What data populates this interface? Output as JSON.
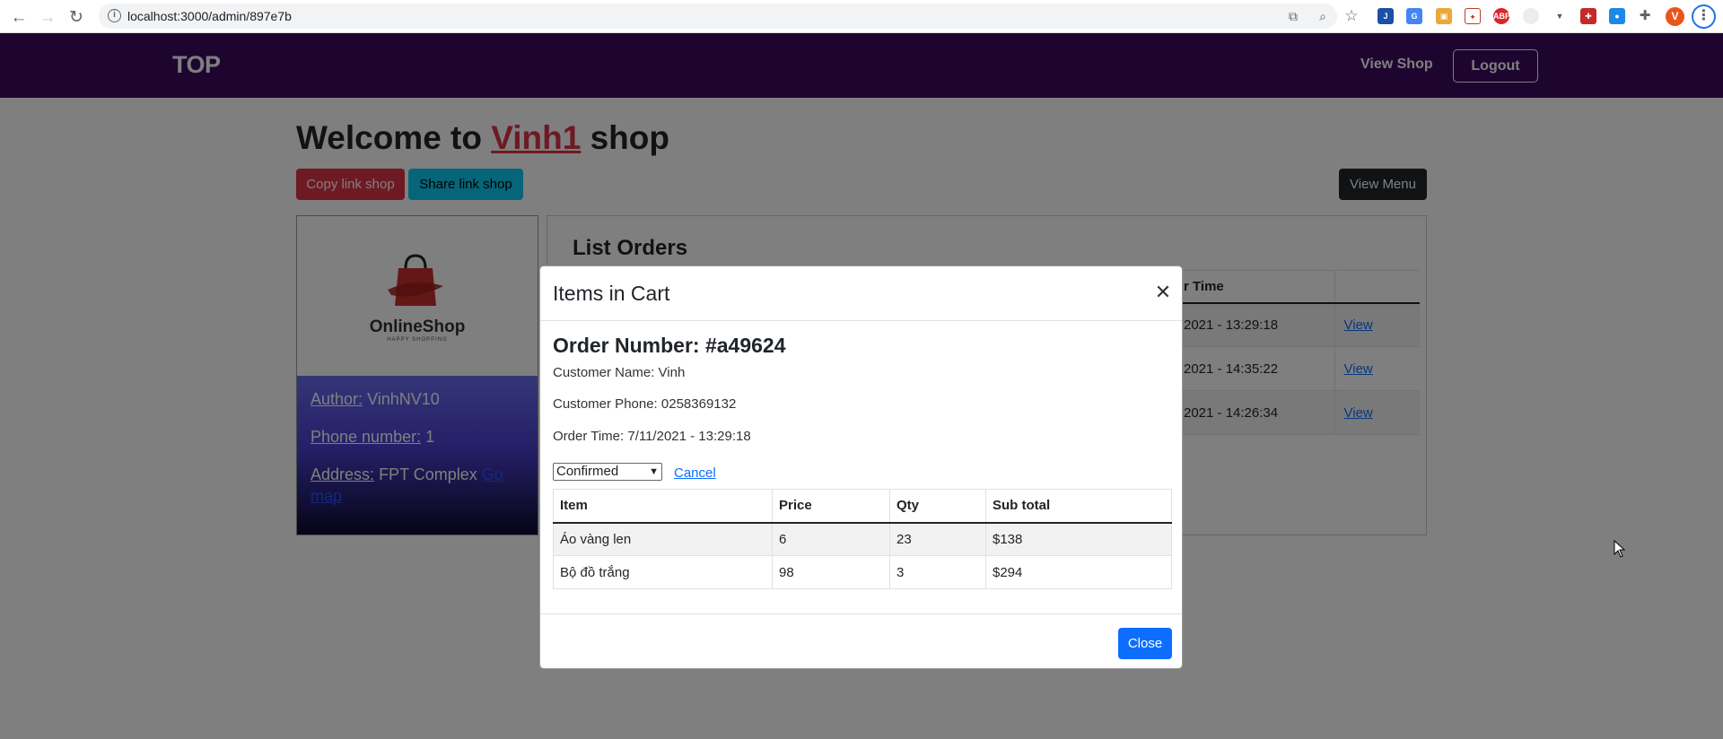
{
  "browser": {
    "url": "localhost:3000/admin/897e7b",
    "profile_initial": "V",
    "extensions": [
      "J",
      "G",
      "▣",
      "✦",
      "ABP",
      "◌",
      "▼",
      "✚",
      "●"
    ]
  },
  "navbar": {
    "brand": "TOP",
    "view_shop": "View Shop",
    "logout": "Logout"
  },
  "welcome": {
    "prefix": "Welcome to",
    "shop_name": "Vinh1",
    "suffix": "shop"
  },
  "buttons": {
    "copy_link": "Copy link shop",
    "share_link": "Share link shop",
    "view_menu": "View Menu"
  },
  "shop_card": {
    "logo_text": "OnlineShop",
    "logo_sub": "HAPPY SHOPPING",
    "author_label": "Author:",
    "author_value": "VinhNV10",
    "phone_label": "Phone number:",
    "phone_value": "1",
    "address_label": "Address:",
    "address_value": "FPT Complex",
    "map_link": "Go map"
  },
  "orders": {
    "title": "List Orders",
    "header_time": "r Time",
    "rows": [
      {
        "time": "2021 - 13:29:18",
        "action": "View"
      },
      {
        "time": "2021 - 14:35:22",
        "action": "View"
      },
      {
        "time": "2021 - 14:26:34",
        "action": "View"
      }
    ]
  },
  "modal": {
    "title": "Items in Cart",
    "order_number": "Order Number: #a49624",
    "customer_name": "Customer Name: Vinh",
    "customer_phone": "Customer Phone: 0258369132",
    "order_time": "Order Time: 7/11/2021 - 13:29:18",
    "status_selected": "Confirmed",
    "cancel": "Cancel",
    "columns": [
      "Item",
      "Price",
      "Qty",
      "Sub total"
    ],
    "items": [
      {
        "item": "Áo vàng len",
        "price": "6",
        "qty": "23",
        "subtotal": "$138"
      },
      {
        "item": "Bộ đồ trắng",
        "price": "98",
        "qty": "3",
        "subtotal": "$294"
      }
    ],
    "close": "Close"
  },
  "colors": {
    "navbar": "#3d0a60",
    "danger": "#dc3545",
    "info": "#0dcaf0",
    "primary": "#0d6efd",
    "dark": "#212529"
  }
}
